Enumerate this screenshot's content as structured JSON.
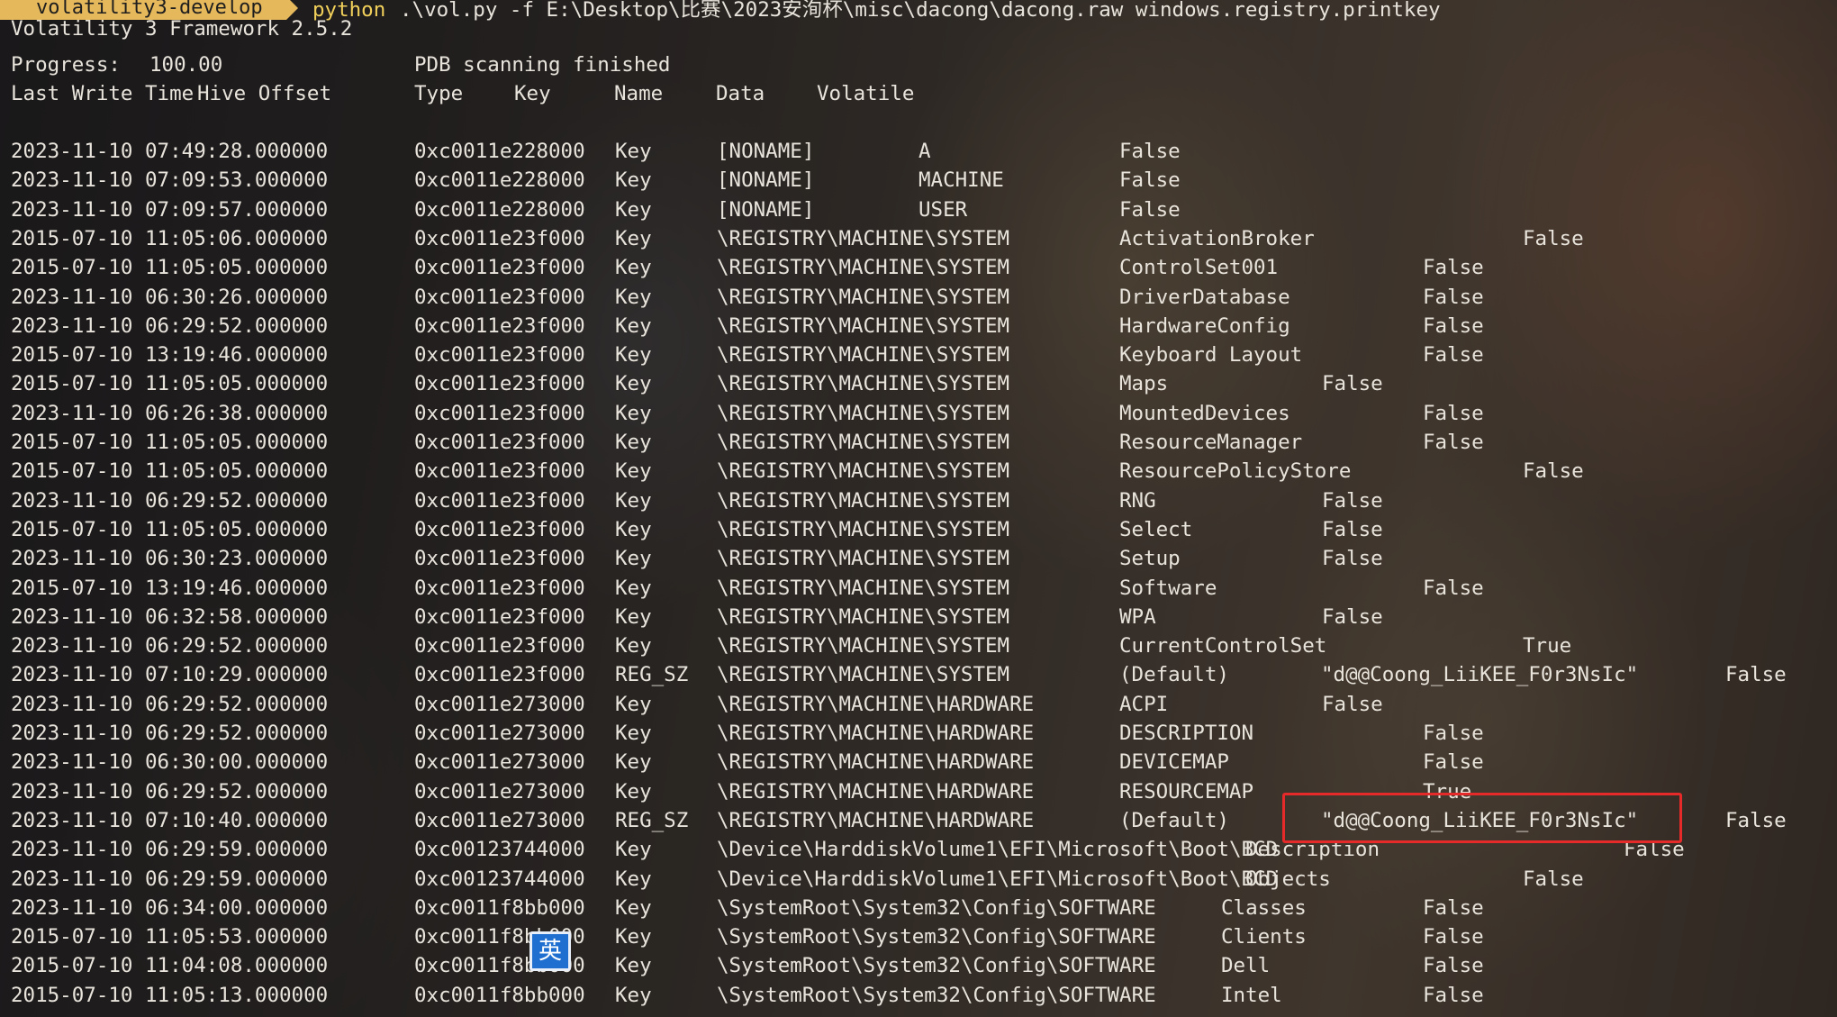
{
  "prompt": {
    "env": "volatility3-develop",
    "command": "python",
    "args": ".\\vol.py -f E:\\Desktop\\比赛\\2023安洵杯\\misc\\dacong\\dacong.raw windows.registry.printkey"
  },
  "output": {
    "framework": "Volatility 3 Framework 2.5.2",
    "progress_label": "Progress:",
    "progress_value": "100.00",
    "progress_status": "PDB scanning finished",
    "headers": [
      "Last Write Time",
      "Hive Offset",
      "Type",
      "Key",
      "Name",
      "Data",
      "Volatile"
    ]
  },
  "rows": [
    {
      "time": "2023-11-10 07:49:28.000000",
      "offset": "0xc0011e228000",
      "type": "Key",
      "key": "[NONAME]",
      "name": "A",
      "data": "",
      "volatile": "False"
    },
    {
      "time": "2023-11-10 07:09:53.000000",
      "offset": "0xc0011e228000",
      "type": "Key",
      "key": "[NONAME]",
      "name": "MACHINE",
      "data": "",
      "volatile": "False"
    },
    {
      "time": "2023-11-10 07:09:57.000000",
      "offset": "0xc0011e228000",
      "type": "Key",
      "key": "[NONAME]",
      "name": "USER",
      "data": "",
      "volatile": "False"
    },
    {
      "time": "2015-07-10 11:05:06.000000",
      "offset": "0xc0011e23f000",
      "type": "Key",
      "key": "\\REGISTRY\\MACHINE\\SYSTEM",
      "name": "ActivationBroker",
      "data": "",
      "volatile": "False"
    },
    {
      "time": "2015-07-10 11:05:05.000000",
      "offset": "0xc0011e23f000",
      "type": "Key",
      "key": "\\REGISTRY\\MACHINE\\SYSTEM",
      "name": "ControlSet001",
      "data": "",
      "volatile": "False"
    },
    {
      "time": "2023-11-10 06:30:26.000000",
      "offset": "0xc0011e23f000",
      "type": "Key",
      "key": "\\REGISTRY\\MACHINE\\SYSTEM",
      "name": "DriverDatabase",
      "data": "",
      "volatile": "False"
    },
    {
      "time": "2023-11-10 06:29:52.000000",
      "offset": "0xc0011e23f000",
      "type": "Key",
      "key": "\\REGISTRY\\MACHINE\\SYSTEM",
      "name": "HardwareConfig",
      "data": "",
      "volatile": "False"
    },
    {
      "time": "2015-07-10 13:19:46.000000",
      "offset": "0xc0011e23f000",
      "type": "Key",
      "key": "\\REGISTRY\\MACHINE\\SYSTEM",
      "name": "Keyboard Layout",
      "data": "",
      "volatile": "False"
    },
    {
      "time": "2015-07-10 11:05:05.000000",
      "offset": "0xc0011e23f000",
      "type": "Key",
      "key": "\\REGISTRY\\MACHINE\\SYSTEM",
      "name": "Maps",
      "data": "",
      "volatile": "False"
    },
    {
      "time": "2023-11-10 06:26:38.000000",
      "offset": "0xc0011e23f000",
      "type": "Key",
      "key": "\\REGISTRY\\MACHINE\\SYSTEM",
      "name": "MountedDevices",
      "data": "",
      "volatile": "False"
    },
    {
      "time": "2015-07-10 11:05:05.000000",
      "offset": "0xc0011e23f000",
      "type": "Key",
      "key": "\\REGISTRY\\MACHINE\\SYSTEM",
      "name": "ResourceManager",
      "data": "",
      "volatile": "False"
    },
    {
      "time": "2015-07-10 11:05:05.000000",
      "offset": "0xc0011e23f000",
      "type": "Key",
      "key": "\\REGISTRY\\MACHINE\\SYSTEM",
      "name": "ResourcePolicyStore",
      "data": "",
      "volatile": "False"
    },
    {
      "time": "2023-11-10 06:29:52.000000",
      "offset": "0xc0011e23f000",
      "type": "Key",
      "key": "\\REGISTRY\\MACHINE\\SYSTEM",
      "name": "RNG",
      "data": "",
      "volatile": "False"
    },
    {
      "time": "2015-07-10 11:05:05.000000",
      "offset": "0xc0011e23f000",
      "type": "Key",
      "key": "\\REGISTRY\\MACHINE\\SYSTEM",
      "name": "Select",
      "data": "",
      "volatile": "False"
    },
    {
      "time": "2023-11-10 06:30:23.000000",
      "offset": "0xc0011e23f000",
      "type": "Key",
      "key": "\\REGISTRY\\MACHINE\\SYSTEM",
      "name": "Setup",
      "data": "",
      "volatile": "False"
    },
    {
      "time": "2015-07-10 13:19:46.000000",
      "offset": "0xc0011e23f000",
      "type": "Key",
      "key": "\\REGISTRY\\MACHINE\\SYSTEM",
      "name": "Software",
      "data": "",
      "volatile": "False"
    },
    {
      "time": "2023-11-10 06:32:58.000000",
      "offset": "0xc0011e23f000",
      "type": "Key",
      "key": "\\REGISTRY\\MACHINE\\SYSTEM",
      "name": "WPA",
      "data": "",
      "volatile": "False"
    },
    {
      "time": "2023-11-10 06:29:52.000000",
      "offset": "0xc0011e23f000",
      "type": "Key",
      "key": "\\REGISTRY\\MACHINE\\SYSTEM",
      "name": "CurrentControlSet",
      "data": "",
      "volatile": "True"
    },
    {
      "time": "2023-11-10 07:10:29.000000",
      "offset": "0xc0011e23f000",
      "type": "REG_SZ",
      "key": "\\REGISTRY\\MACHINE\\SYSTEM",
      "name": "(Default)",
      "data": "\"d@@Coong_LiiKEE_F0r3NsIc\"",
      "volatile": "False"
    },
    {
      "time": "2023-11-10 06:29:52.000000",
      "offset": "0xc0011e273000",
      "type": "Key",
      "key": "\\REGISTRY\\MACHINE\\HARDWARE",
      "name": "ACPI",
      "data": "",
      "volatile": "False"
    },
    {
      "time": "2023-11-10 06:29:52.000000",
      "offset": "0xc0011e273000",
      "type": "Key",
      "key": "\\REGISTRY\\MACHINE\\HARDWARE",
      "name": "DESCRIPTION",
      "data": "",
      "volatile": "False"
    },
    {
      "time": "2023-11-10 06:30:00.000000",
      "offset": "0xc0011e273000",
      "type": "Key",
      "key": "\\REGISTRY\\MACHINE\\HARDWARE",
      "name": "DEVICEMAP",
      "data": "",
      "volatile": "False"
    },
    {
      "time": "2023-11-10 06:29:52.000000",
      "offset": "0xc0011e273000",
      "type": "Key",
      "key": "\\REGISTRY\\MACHINE\\HARDWARE",
      "name": "RESOURCEMAP",
      "data": "",
      "volatile": "True"
    },
    {
      "time": "2023-11-10 07:10:40.000000",
      "offset": "0xc0011e273000",
      "type": "REG_SZ",
      "key": "\\REGISTRY\\MACHINE\\HARDWARE",
      "name": "(Default)",
      "data": "\"d@@Coong_LiiKEE_F0r3NsIc\"",
      "volatile": "False"
    },
    {
      "time": "2023-11-10 06:29:59.000000",
      "offset": "0xc00123744000",
      "type": "Key",
      "key": "\\Device\\HarddiskVolume1\\EFI\\Microsoft\\Boot\\BCD",
      "name": "Description",
      "data": "",
      "volatile": "False"
    },
    {
      "time": "2023-11-10 06:29:59.000000",
      "offset": "0xc00123744000",
      "type": "Key",
      "key": "\\Device\\HarddiskVolume1\\EFI\\Microsoft\\Boot\\BCD",
      "name": "Objects",
      "data": "",
      "volatile": "False"
    },
    {
      "time": "2023-11-10 06:34:00.000000",
      "offset": "0xc0011f8bb000",
      "type": "Key",
      "key": "\\SystemRoot\\System32\\Config\\SOFTWARE",
      "name": "Classes",
      "data": "",
      "volatile": "False"
    },
    {
      "time": "2015-07-10 11:05:53.000000",
      "offset": "0xc0011f8bb000",
      "type": "Key",
      "key": "\\SystemRoot\\System32\\Config\\SOFTWARE",
      "name": "Clients",
      "data": "",
      "volatile": "False"
    },
    {
      "time": "2015-07-10 11:04:08.000000",
      "offset": "0xc0011f8bb000",
      "type": "Key",
      "key": "\\SystemRoot\\System32\\Config\\SOFTWARE",
      "name": "Dell",
      "data": "",
      "volatile": "False"
    },
    {
      "time": "2015-07-10 11:05:13.000000",
      "offset": "0xc0011f8bb000",
      "type": "Key",
      "key": "\\SystemRoot\\System32\\Config\\SOFTWARE",
      "name": "Intel",
      "data": "",
      "volatile": "False"
    }
  ],
  "ime": {
    "label": "英"
  },
  "colors": {
    "badge": "#e6b85c",
    "command": "#f0d05a",
    "highlight": "#e62a2a",
    "ime": "#1f6fd1"
  }
}
